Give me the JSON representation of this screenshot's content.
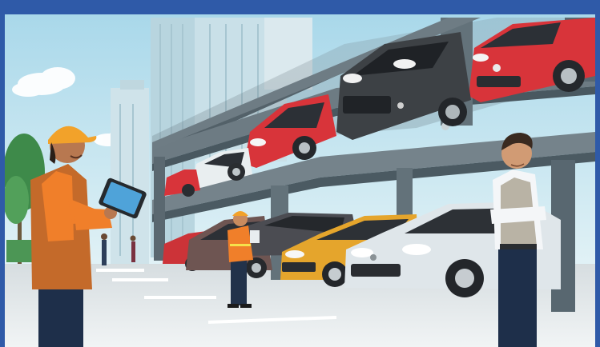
{
  "scene": {
    "colors": {
      "frame": "#2f5aa8",
      "sky": "#bfe3ef",
      "structure": "#5f6f78",
      "ground": "#e3e8ea",
      "red_car": "#d8343a",
      "dark_car": "#3d4145",
      "silver_car": "#dfe6ea",
      "yellow_car": "#e5a52c",
      "safety_orange": "#f07f2a",
      "hard_hat": "#f2a22a"
    }
  }
}
